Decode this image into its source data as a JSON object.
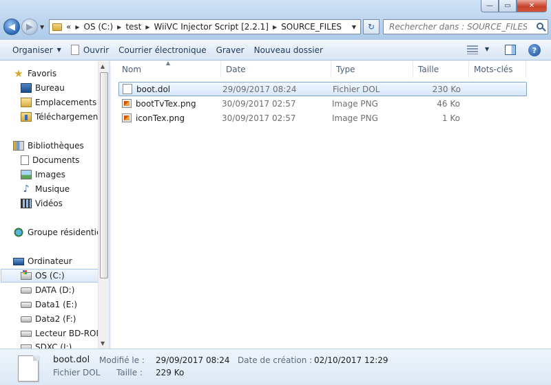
{
  "window": {
    "controls": {
      "minimize": "—",
      "maximize": "▭",
      "close": "✕"
    }
  },
  "address": {
    "overflow": "«",
    "segments": [
      "OS (C:)",
      "test",
      "WiiVC Injector Script [2.2.1]",
      "SOURCE_FILES"
    ]
  },
  "search": {
    "placeholder": "Rechercher dans : SOURCE_FILES"
  },
  "toolbar": {
    "organize": "Organiser",
    "open": "Ouvrir",
    "email": "Courrier électronique",
    "burn": "Graver",
    "new_folder": "Nouveau dossier"
  },
  "nav": {
    "favorites": "Favoris",
    "desktop": "Bureau",
    "recent": "Emplacements ré",
    "downloads": "Téléchargements",
    "libraries": "Bibliothèques",
    "documents": "Documents",
    "images": "Images",
    "music": "Musique",
    "videos": "Vidéos",
    "homegroup": "Groupe résidentiel",
    "computer": "Ordinateur",
    "drive_c": "OS (C:)",
    "drive_d": "DATA (D:)",
    "drive_e": "Data1 (E:)",
    "drive_f": "Data2 (F:)",
    "drive_bd": "Lecteur BD-ROM",
    "drive_sd": "SDXC (I:)"
  },
  "columns": {
    "name": "Nom",
    "date": "Date",
    "type": "Type",
    "size": "Taille",
    "tags": "Mots-clés"
  },
  "files": [
    {
      "name": "boot.dol",
      "date": "29/09/2017 08:24",
      "type": "Fichier DOL",
      "size": "230 Ko",
      "icon": "blank-file-icon",
      "selected": true
    },
    {
      "name": "bootTvTex.png",
      "date": "30/09/2017 02:57",
      "type": "Image PNG",
      "size": "46 Ko",
      "icon": "png-file-icon",
      "selected": false
    },
    {
      "name": "iconTex.png",
      "date": "30/09/2017 02:57",
      "type": "Image PNG",
      "size": "1 Ko",
      "icon": "png-file-icon",
      "selected": false
    }
  ],
  "details": {
    "name": "boot.dol",
    "type": "Fichier DOL",
    "modified_label": "Modifié le :",
    "modified": "29/09/2017 08:24",
    "size_label": "Taille :",
    "size": "229 Ko",
    "created_label": "Date de création :",
    "created": "02/10/2017 12:29"
  },
  "colors": {
    "selection_bg": "#d6e8fc",
    "selection_border": "#7da2ce",
    "accent": "#1e395b"
  }
}
